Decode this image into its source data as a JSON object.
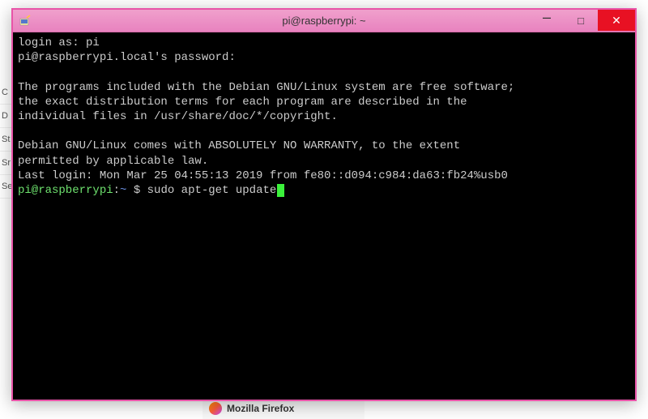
{
  "window": {
    "title": "pi@raspberrypi: ~",
    "controls": {
      "minimize": "–",
      "maximize": "□",
      "close": "✕"
    }
  },
  "terminal": {
    "line1": "login as: pi",
    "line2": "pi@raspberrypi.local's password:",
    "blank1": " ",
    "line3": "The programs included with the Debian GNU/Linux system are free software;",
    "line4": "the exact distribution terms for each program are described in the",
    "line5": "individual files in /usr/share/doc/*/copyright.",
    "blank2": " ",
    "line6": "Debian GNU/Linux comes with ABSOLUTELY NO WARRANTY, to the extent",
    "line7": "permitted by applicable law.",
    "line8": "Last login: Mon Mar 25 04:55:13 2019 from fe80::d094:c984:da63:fb24%usb0",
    "prompt_user": "pi@raspberrypi",
    "prompt_sep": ":",
    "prompt_path": "~",
    "prompt_dollar": " $ ",
    "command": "sudo apt-get update"
  },
  "background": {
    "sidebar_items": [
      "C",
      "D",
      "St",
      "Sr",
      "Se"
    ],
    "taskbar_label": "Mozilla Firefox"
  }
}
